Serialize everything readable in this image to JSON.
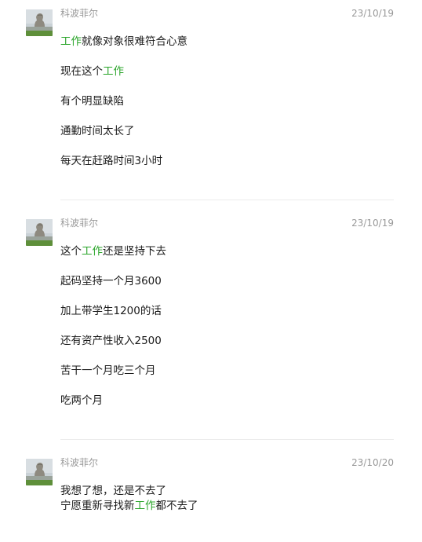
{
  "messages": [
    {
      "sender": "科波菲尔",
      "date": "23/10/19",
      "avatar_icon": "statue-photo-avatar",
      "lines": [
        {
          "pre": "",
          "kw": "工作",
          "post": "就像对象很难符合心意"
        },
        {
          "pre": "现在这个",
          "kw": "工作",
          "post": ""
        },
        {
          "pre": "有个明显缺陷",
          "kw": "",
          "post": ""
        },
        {
          "pre": "通勤时间太长了",
          "kw": "",
          "post": ""
        },
        {
          "pre": "每天在赶路时间3小时",
          "kw": "",
          "post": ""
        }
      ]
    },
    {
      "sender": "科波菲尔",
      "date": "23/10/19",
      "avatar_icon": "statue-photo-avatar",
      "lines": [
        {
          "pre": "这个",
          "kw": "工作",
          "post": "还是坚持下去"
        },
        {
          "pre": "起码坚持一个月3600",
          "kw": "",
          "post": ""
        },
        {
          "pre": "加上带学生1200的话",
          "kw": "",
          "post": ""
        },
        {
          "pre": "还有资产性收入2500",
          "kw": "",
          "post": ""
        },
        {
          "pre": "苦干一个月吃三个月",
          "kw": "",
          "post": ""
        },
        {
          "pre": "吃两个月",
          "kw": "",
          "post": ""
        }
      ]
    },
    {
      "sender": "科波菲尔",
      "date": "23/10/20",
      "avatar_icon": "statue-photo-avatar",
      "lines": [
        {
          "pre": "我想了想，还是不去了",
          "kw": "",
          "post": ""
        },
        {
          "pre": "宁愿重新寻找新",
          "kw": "工作",
          "post": "都不去了"
        }
      ]
    }
  ],
  "colors": {
    "keyword": "#2aa52a",
    "meta": "#9a9a9a",
    "text": "#1a1a1a"
  }
}
